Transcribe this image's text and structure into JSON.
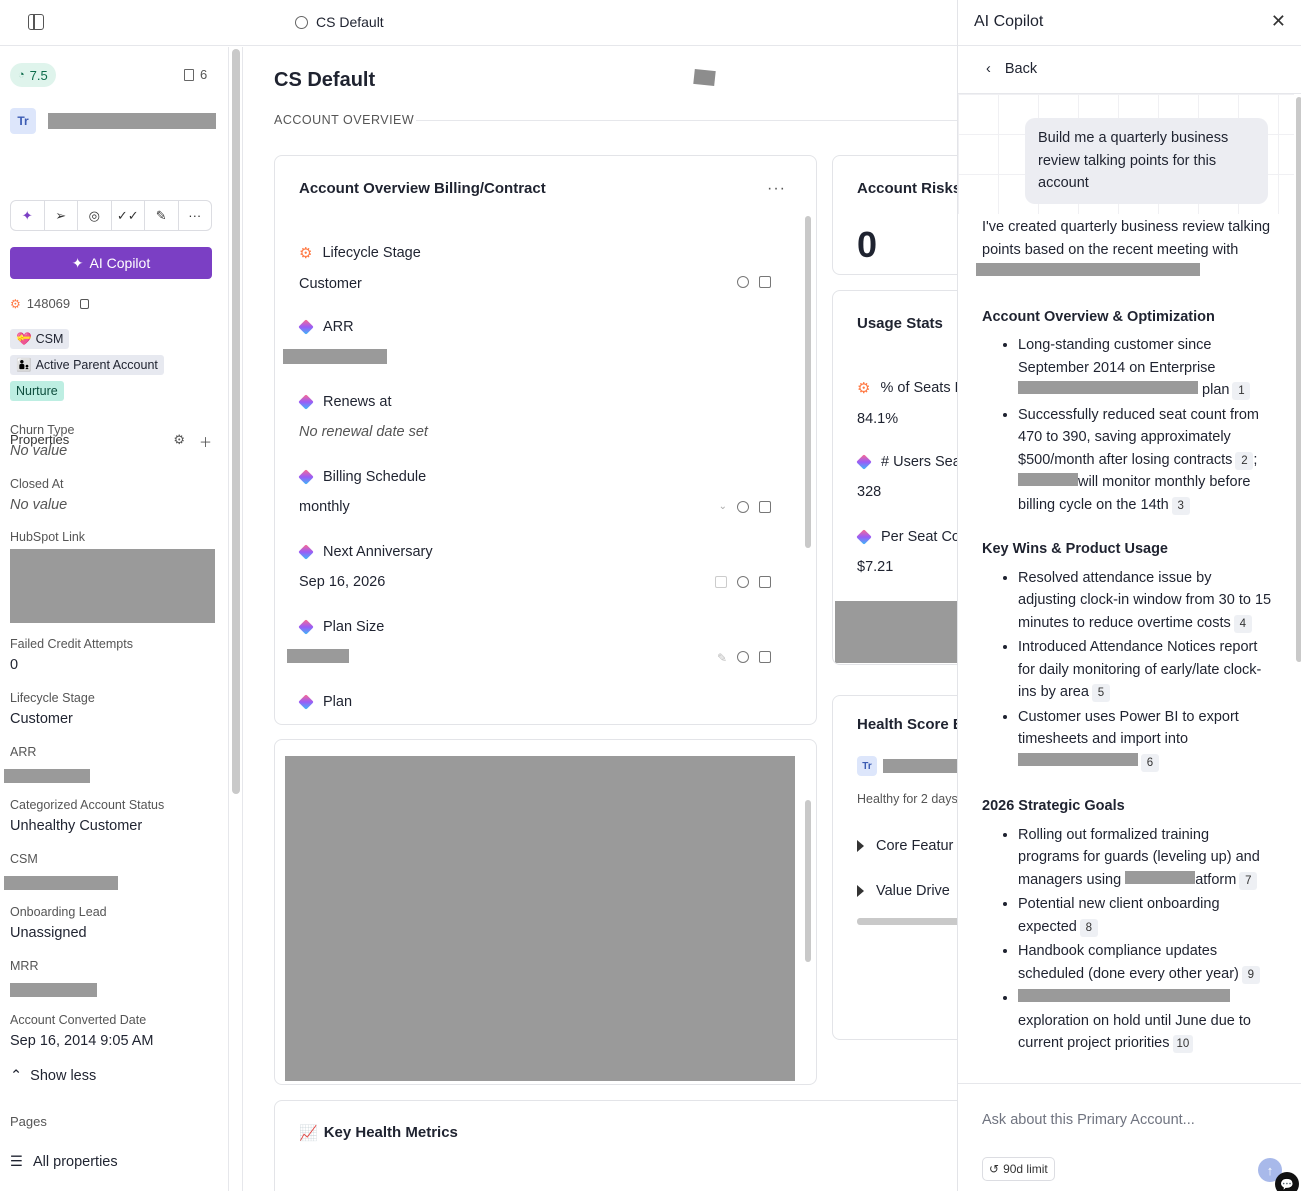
{
  "topbar": {
    "breadcrumb": "CS Default"
  },
  "sidebar": {
    "score": "7.5",
    "count": "6",
    "avatar": "Tr",
    "copilot_label": "AI Copilot",
    "account_id": "148069",
    "tags": {
      "csm": "CSM",
      "active": "Active Parent Account",
      "nurture": "Nurture"
    },
    "properties_label": "Properties",
    "props": [
      {
        "label": "Churn Type",
        "value": "No value"
      },
      {
        "label": "Closed At",
        "value": "No value"
      },
      {
        "label": "HubSpot Link",
        "value": ""
      },
      {
        "label": "Failed Credit Attempts",
        "value": "0"
      },
      {
        "label": "Lifecycle Stage",
        "value": "Customer"
      },
      {
        "label": "ARR",
        "value": ""
      },
      {
        "label": "Categorized Account Status",
        "value": "Unhealthy Customer"
      },
      {
        "label": "CSM",
        "value": ""
      },
      {
        "label": "Onboarding Lead",
        "value": "Unassigned"
      },
      {
        "label": "MRR",
        "value": ""
      },
      {
        "label": "Account Converted Date",
        "value": "Sep 16, 2014 9:05 AM"
      }
    ],
    "show_less": "Show less",
    "pages_label": "Pages",
    "all_properties": "All properties"
  },
  "main": {
    "title": "CS Default",
    "section": "ACCOUNT OVERVIEW",
    "billing": {
      "title": "Account Overview Billing/Contract",
      "fields": [
        {
          "label": "Lifecycle Stage",
          "value": "Customer"
        },
        {
          "label": "ARR",
          "value": ""
        },
        {
          "label": "Renews at",
          "value": "No renewal date set"
        },
        {
          "label": "Billing Schedule",
          "value": "monthly"
        },
        {
          "label": "Next Anniversary",
          "value": "Sep 16, 2026"
        },
        {
          "label": "Plan Size",
          "value": ""
        },
        {
          "label": "Plan",
          "value": ""
        }
      ]
    },
    "risks": {
      "title": "Account Risks",
      "value": "0"
    },
    "usage": {
      "title": "Usage Stats",
      "fields": [
        {
          "label": "% of Seats F",
          "value": "84.1%"
        },
        {
          "label": "# Users Sea",
          "value": "328"
        },
        {
          "label": "Per Seat Co",
          "value": "$7.21"
        }
      ]
    },
    "health": {
      "title": "Health Score B",
      "avatar": "Tr",
      "sub": "Healthy for 2 days",
      "rows": [
        "Core Featur",
        "Value Drive"
      ]
    },
    "metrics": {
      "emoji": "📈",
      "title": "Key Health Metrics"
    }
  },
  "copilot": {
    "title": "AI Copilot",
    "back": "Back",
    "user_message": "Build me a quarterly business review talking points for this account",
    "intro": "I've created quarterly business review talking points based on the recent meeting with",
    "sections": [
      {
        "heading": "Account Overview & Optimization",
        "items": [
          {
            "pre": "Long-standing customer since September 2014 on Enterprise",
            "redact": true,
            "post": "plan",
            "cite": "1"
          },
          {
            "pre": "Successfully reduced seat count from 470 to 390, saving approximately $500/month after losing contracts",
            "cite": "2",
            "tail": ";",
            "pre2": "",
            "redact2": true,
            "post2": "will monitor monthly before billing cycle on the 14th",
            "cite2": "3"
          }
        ]
      },
      {
        "heading": "Key Wins & Product Usage",
        "items": [
          {
            "pre": "Resolved attendance issue by adjusting clock-in window from 30 to 15 minutes to reduce overtime costs",
            "cite": "4"
          },
          {
            "pre": "Introduced Attendance Notices report for daily monitoring of early/late clock-ins by area",
            "cite": "5"
          },
          {
            "pre": "Customer uses Power BI to export timesheets and import into",
            "redact": true,
            "post": "",
            "cite": "6"
          }
        ]
      },
      {
        "heading": "2026 Strategic Goals",
        "items": [
          {
            "pre": "Rolling out formalized training programs for guards (leveling up) and managers using",
            "redact": true,
            "post": "atform",
            "cite": "7"
          },
          {
            "pre": "Potential new client onboarding expected",
            "cite": "8"
          },
          {
            "pre": "Handbook compliance updates scheduled (done every other year)",
            "cite": "9"
          },
          {
            "pre": "",
            "redact": true,
            "post": "exploration on hold until June due to current project priorities",
            "cite": "10"
          }
        ]
      }
    ],
    "input_placeholder": "Ask about this Primary Account...",
    "limit": "90d limit"
  }
}
